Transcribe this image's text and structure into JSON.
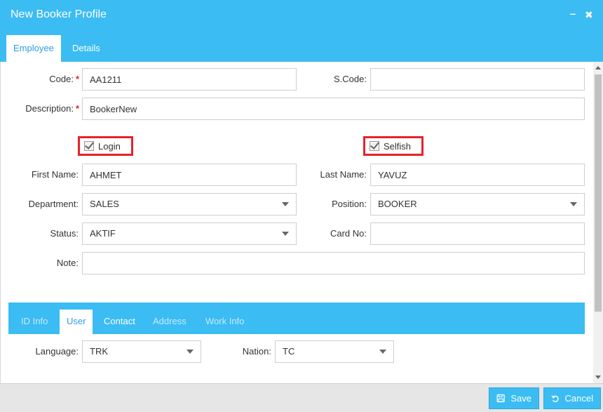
{
  "window": {
    "title": "New Booker Profile",
    "minimize_glyph": "‒",
    "close_glyph": "✖"
  },
  "tabs": [
    {
      "label": "Employee"
    },
    {
      "label": "Details"
    }
  ],
  "form": {
    "code": {
      "label": "Code:",
      "value": "AA1211"
    },
    "scode": {
      "label": "S.Code:",
      "value": ""
    },
    "description": {
      "label": "Description:",
      "value": "BookerNew"
    },
    "required_mark": "*",
    "login": {
      "label": "Login",
      "checked": true
    },
    "selfish": {
      "label": "Selfish",
      "checked": true
    },
    "first_name": {
      "label": "First Name:",
      "value": "AHMET"
    },
    "last_name": {
      "label": "Last Name:",
      "value": "YAVUZ"
    },
    "department": {
      "label": "Department:",
      "value": "SALES"
    },
    "position": {
      "label": "Position:",
      "value": "BOOKER"
    },
    "status": {
      "label": "Status:",
      "value": "AKTIF"
    },
    "card_no": {
      "label": "Card No:",
      "value": ""
    },
    "note": {
      "label": "Note:",
      "value": ""
    }
  },
  "subtabs": [
    {
      "label": "ID Info"
    },
    {
      "label": "User"
    },
    {
      "label": "Contact"
    },
    {
      "label": "Address"
    },
    {
      "label": "Work Info"
    }
  ],
  "user": {
    "language": {
      "label": "Language:",
      "value": "TRK"
    },
    "nation": {
      "label": "Nation:",
      "value": "TC"
    }
  },
  "footer": {
    "save_label": "Save",
    "cancel_label": "Cancel"
  },
  "colors": {
    "accent": "#3bbcf3",
    "required": "#e3242b",
    "highlight_border": "#e3242b"
  }
}
